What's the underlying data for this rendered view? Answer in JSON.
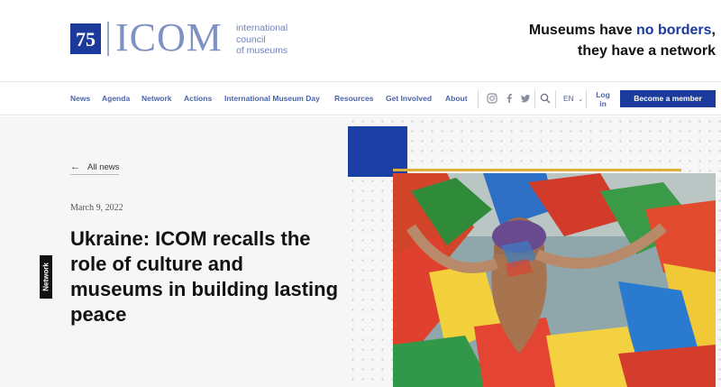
{
  "logo": {
    "mark_number": "75",
    "wordmark": "ICOM",
    "tagline_lines": [
      "international",
      "council",
      "of museums"
    ]
  },
  "tagline": {
    "line1_pre": "Museums have ",
    "line1_accent": "no borders",
    "line1_post": ",",
    "line2": "they have a network"
  },
  "nav": {
    "items": [
      "News",
      "Agenda",
      "Network",
      "Actions",
      "International Museum Day",
      "Resources",
      "Get Involved",
      "About"
    ],
    "icons": [
      "instagram-icon",
      "facebook-icon",
      "twitter-icon",
      "search-icon"
    ],
    "language": "EN",
    "login_line1": "Log",
    "login_line2": "in",
    "member_button": "Become a member"
  },
  "article": {
    "back_label": "All news",
    "date": "March 9, 2022",
    "title": "Ukraine: ICOM recalls the role of culture and museums in building lasting peace",
    "category": "Network"
  },
  "colors": {
    "brand_blue": "#1b3a9c",
    "logo_blue": "#7f90c3",
    "accent_gold": "#e0b03a"
  }
}
